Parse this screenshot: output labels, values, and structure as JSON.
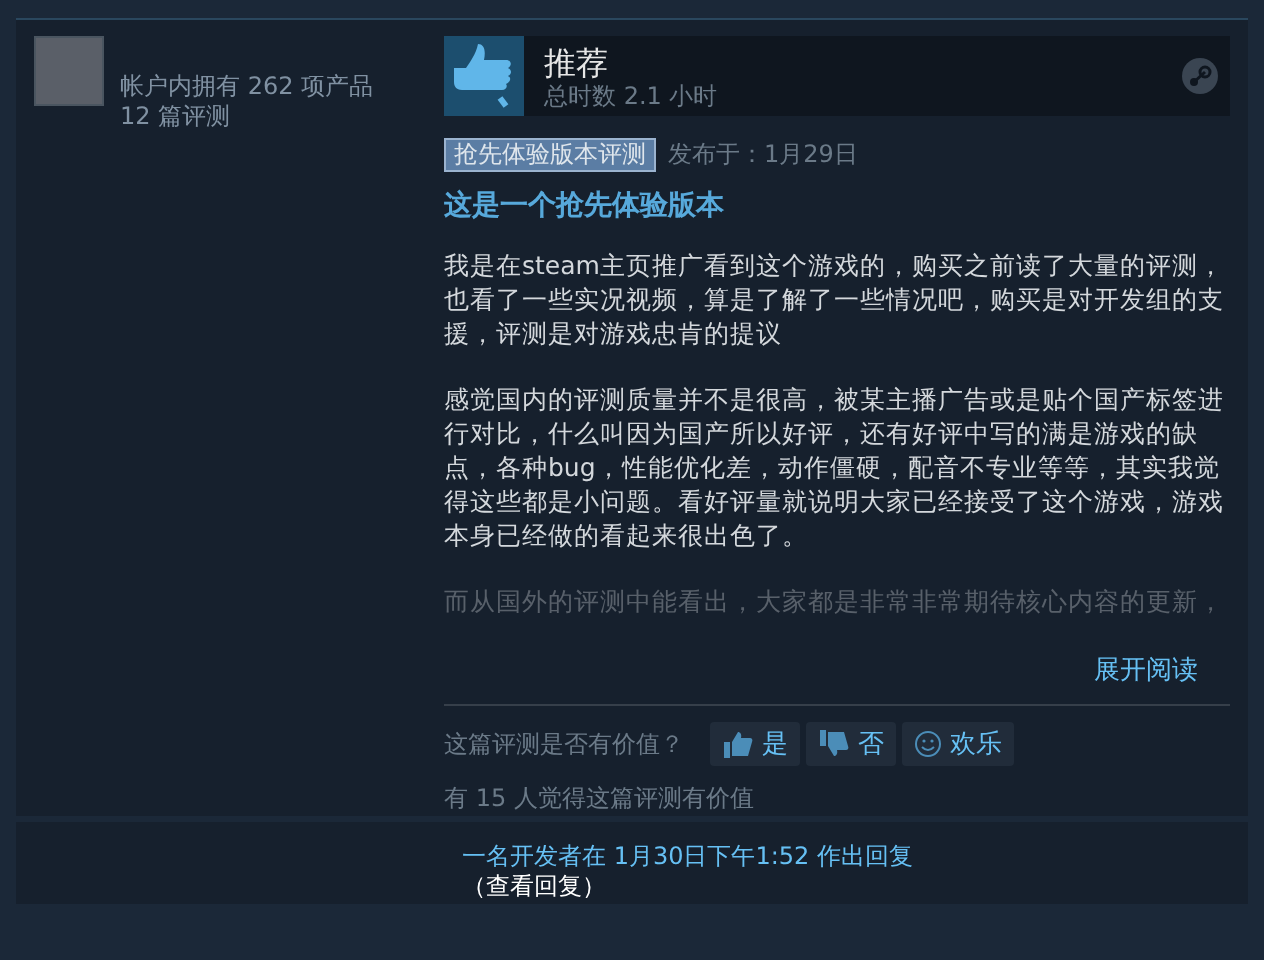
{
  "author": {
    "products": "帐户内拥有 262 项产品",
    "reviews": "12 篇评测"
  },
  "header": {
    "verdict": "推荐",
    "hours": "总时数 2.1 小时",
    "recommended": true
  },
  "meta": {
    "tag": "抢先体验版本评测",
    "posted": "发布于：1月29日"
  },
  "title": "这是一个抢先体验版本",
  "paragraphs": [
    "我是在steam主页推广看到这个游戏的，购买之前读了大量的评测，也看了一些实况视频，算是了解了一些情况吧，购买是对开发组的支援，评测是对游戏忠肯的提议",
    "感觉国内的评测质量并不是很高，被某主播广告或是贴个国产标签进行对比，什么叫因为国产所以好评，还有好评中写的满是游戏的缺点，各种bug，性能优化差，动作僵硬，配音不专业等等，其实我觉得这些都是小问题。看好评量就说明大家已经接受了这个游戏，游戏本身已经做的看起来很出色了。",
    "而从国外的评测中能看出，大家都是非常非常期待核心内容的更新，"
  ],
  "expand": "展开阅读",
  "vote": {
    "question": "这篇评测是否有价值？",
    "buttons": [
      {
        "kind": "up",
        "label": "是"
      },
      {
        "kind": "down",
        "label": "否"
      },
      {
        "kind": "funny",
        "label": "欢乐"
      }
    ],
    "helpful": "有 15 人觉得这篇评测有价值"
  },
  "developer_reply": {
    "text": "一名开发者在 1月30日下午1:52 作出回复",
    "link": "（查看回复）"
  }
}
